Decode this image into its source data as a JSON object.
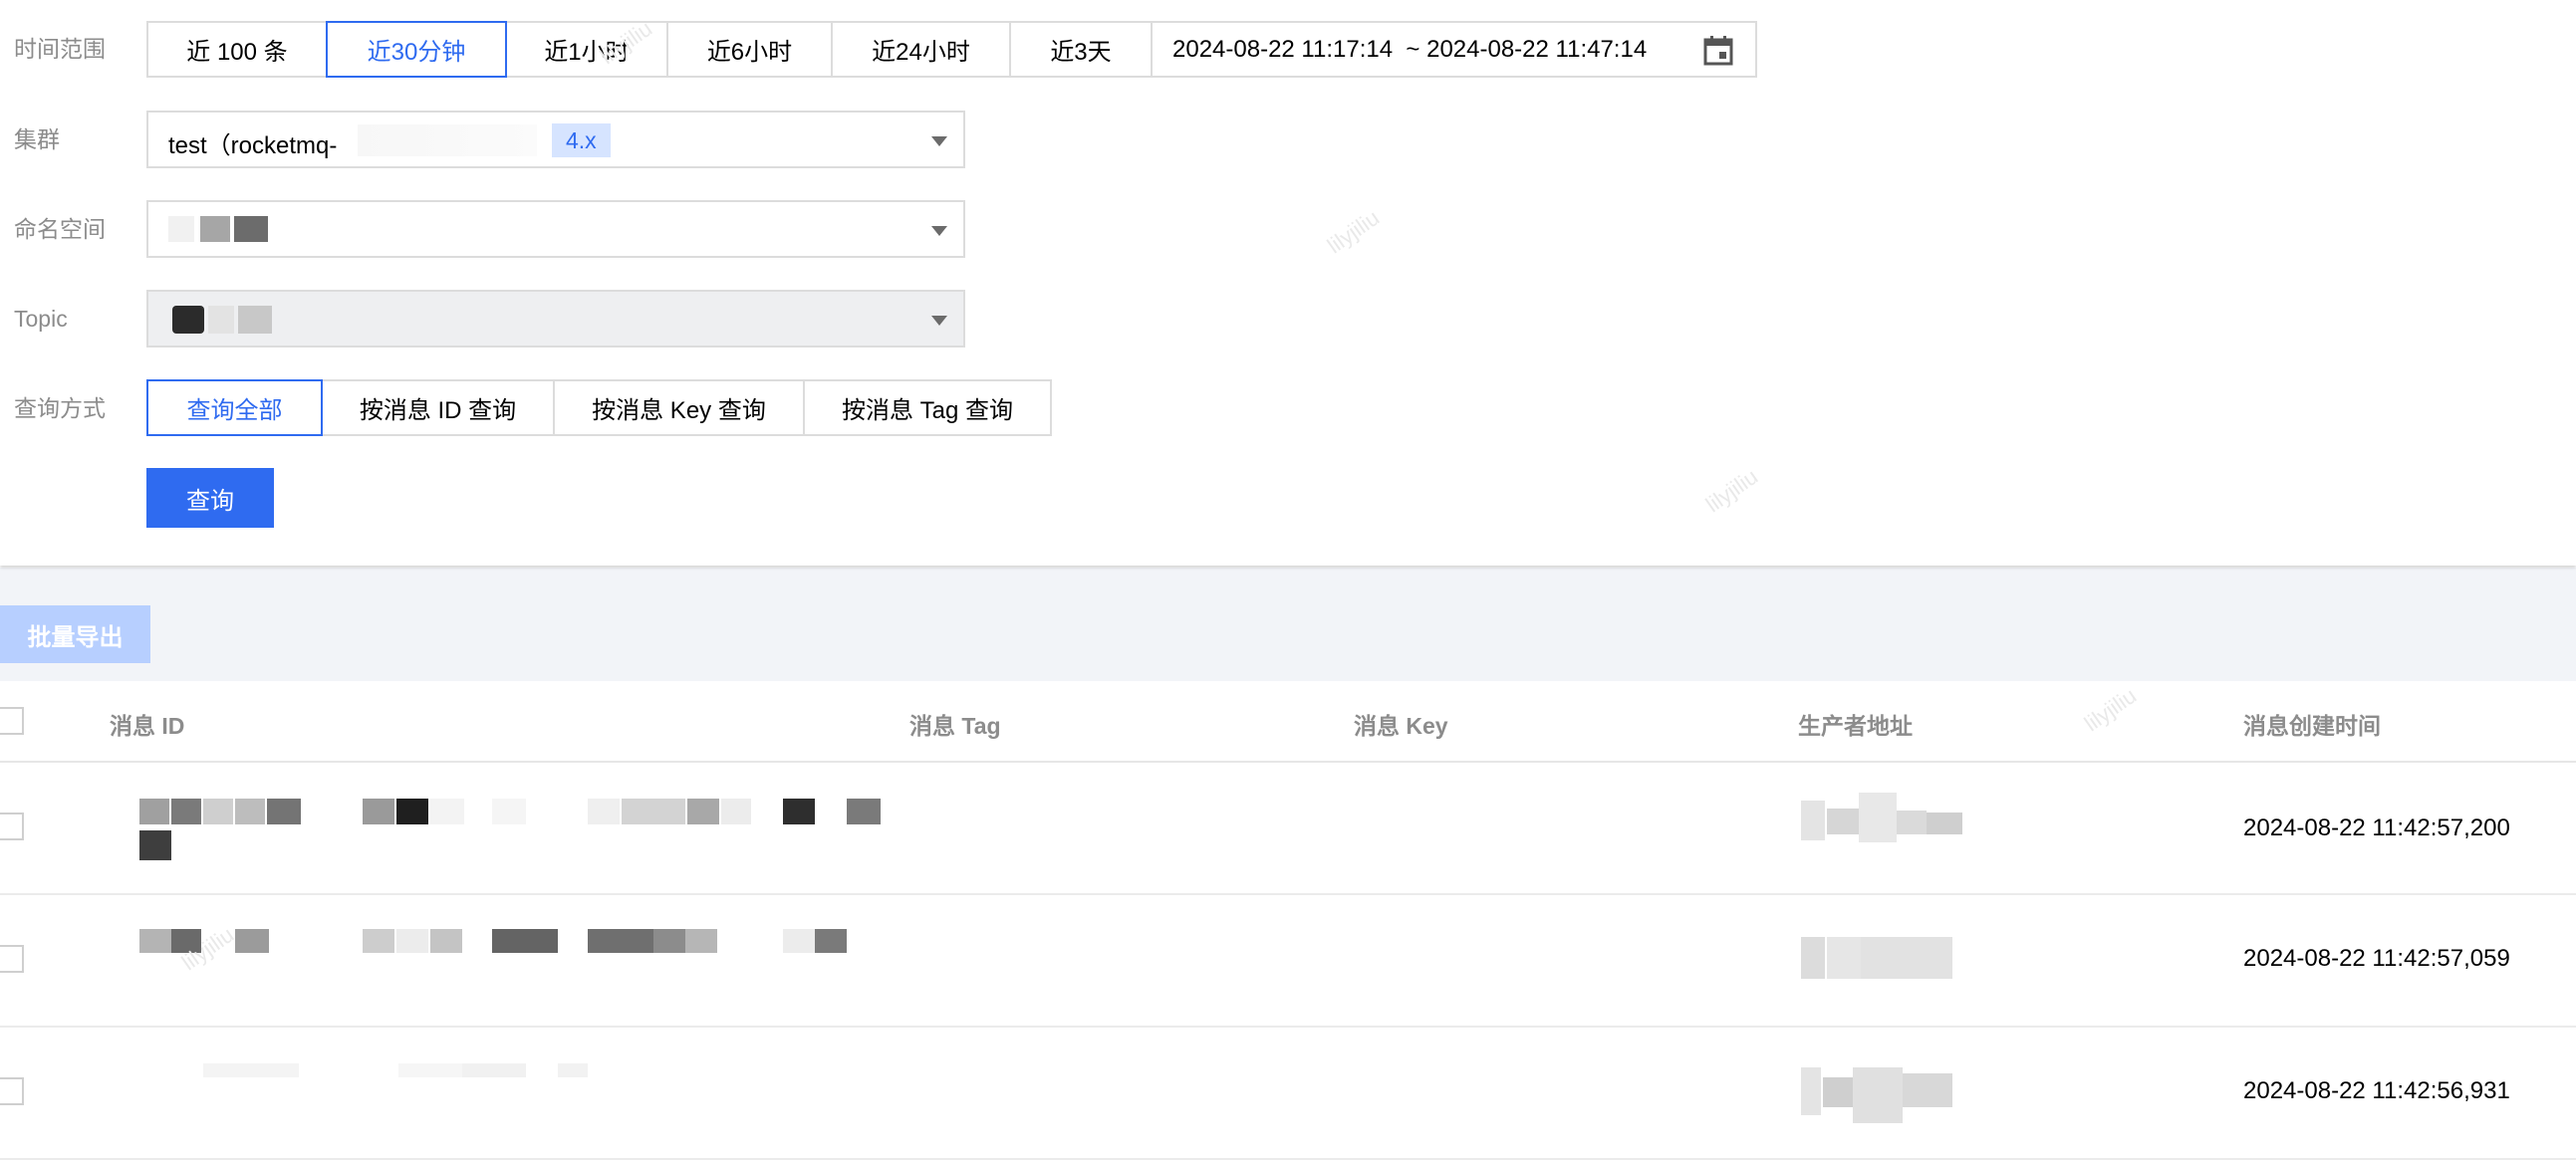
{
  "form": {
    "time_range": {
      "label": "时间范围",
      "options": [
        "近 100 条",
        "近30分钟",
        "近1小时",
        "近6小时",
        "近24小时",
        "近3天"
      ],
      "active_index": 1,
      "range_text": "2024-08-22 11:17:14  ~ 2024-08-22 11:47:14",
      "calendar_icon": "calendar-icon"
    },
    "cluster": {
      "label": "集群",
      "value": "test（rocketmq-",
      "version_tag": "4.x"
    },
    "namespace": {
      "label": "命名空间"
    },
    "topic": {
      "label": "Topic"
    },
    "query_mode": {
      "label": "查询方式",
      "options": [
        "查询全部",
        "按消息 ID 查询",
        "按消息 Key 查询",
        "按消息 Tag 查询"
      ],
      "active_index": 0
    },
    "submit_label": "查询"
  },
  "toolbar": {
    "export_label": "批量导出"
  },
  "table": {
    "columns": [
      "消息 ID",
      "消息 Tag",
      "消息 Key",
      "生产者地址",
      "消息创建时间"
    ],
    "rows": [
      {
        "created": "2024-08-22 11:42:57,200"
      },
      {
        "created": "2024-08-22 11:42:57,059"
      },
      {
        "created": "2024-08-22 11:42:56,931"
      }
    ]
  },
  "watermark": "lilyjiliu",
  "colors": {
    "accent": "#2f6bf0",
    "export_disabled": "#b7cfff",
    "border": "#dcdcdc"
  }
}
